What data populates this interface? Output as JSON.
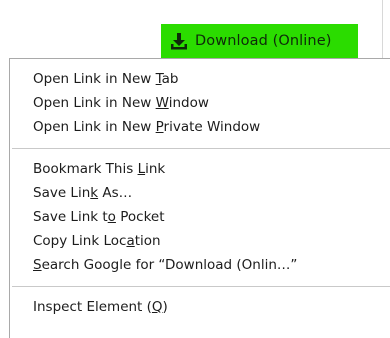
{
  "download_button": {
    "label": "Download (Online)",
    "icon": "download-icon",
    "color": "#2bdc00"
  },
  "menu": {
    "groups": [
      {
        "items": [
          {
            "pre": "Open Link in New ",
            "key": "T",
            "post": "ab"
          },
          {
            "pre": "Open Link in New ",
            "key": "W",
            "post": "indow"
          },
          {
            "pre": "Open Link in New ",
            "key": "P",
            "post": "rivate Window"
          }
        ]
      },
      {
        "items": [
          {
            "pre": "Bookmark This ",
            "key": "L",
            "post": "ink"
          },
          {
            "pre": "Save Lin",
            "key": "k",
            "post": " As…"
          },
          {
            "pre": "Save Link t",
            "key": "o",
            "post": " Pocket"
          },
          {
            "pre": "Copy Link Loc",
            "key": "a",
            "post": "tion"
          },
          {
            "pre": "",
            "key": "S",
            "post": "earch Google for “Download (Onlin…”"
          }
        ]
      },
      {
        "items": [
          {
            "pre": "Inspect Element (",
            "key": "Q",
            "post": ")"
          }
        ]
      }
    ]
  }
}
